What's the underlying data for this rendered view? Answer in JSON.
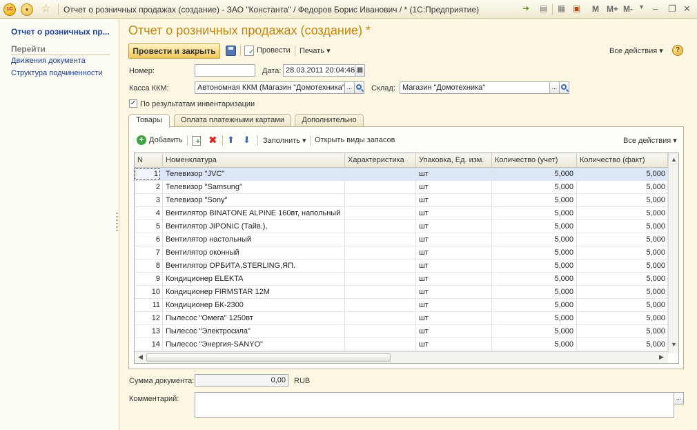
{
  "window": {
    "title": "Отчет о розничных продажах (создание) - ЗАО \"Константа\" / Федоров Борис Иванович / * (1С:Предприятие)",
    "logo": "1С",
    "menu_glyph": "▾",
    "favorite_glyph": "☆",
    "memory_buttons": [
      "M",
      "M+",
      "M-"
    ],
    "minimize": "–",
    "restore": "❐",
    "close": "✕"
  },
  "left_panel": {
    "title": "Отчет о розничных пр...",
    "section": "Перейти",
    "links": [
      "Движения документа",
      "Структура подчиненности"
    ]
  },
  "form": {
    "title": "Отчет о розничных продажах (создание) *",
    "toolbar": {
      "post_and_close": "Провести и закрыть",
      "post": "Провести",
      "print": "Печать ▾",
      "all_actions": "Все действия ▾",
      "help": "?"
    },
    "fields": {
      "number_label": "Номер:",
      "number_value": "",
      "date_label": "Дата:",
      "date_value": "28.03.2011 20:04:46",
      "cash_label": "Касса ККМ:",
      "cash_value": "Автономная ККМ (Магазин \"Домотехника\")",
      "warehouse_label": "Склад:",
      "warehouse_value": "Магазин \"Домотехника\"",
      "ellipsis": "...",
      "inventory_checkbox_label": "По результатам инвентаризации",
      "inventory_checked": "✓"
    },
    "tabs": [
      "Товары",
      "Оплата платежными картами",
      "Дополнительно"
    ],
    "table_toolbar": {
      "add": "Добавить",
      "add_glyph": "+",
      "delete_glyph": "✖",
      "up_glyph": "⬆",
      "down_glyph": "⬇",
      "fill": "Заполнить ▾",
      "open_stock_types": "Открыть виды запасов",
      "all_actions": "Все действия ▾"
    },
    "table": {
      "columns": [
        "N",
        "Номенклатура",
        "Характеристика",
        "Упаковка, Ед. изм.",
        "Количество (учет)",
        "Количество (факт)"
      ],
      "rows": [
        {
          "n": "1",
          "name": "Телевизор \"JVC\"",
          "char": "",
          "unit": "шт",
          "q1": "5,000",
          "q2": "5,000"
        },
        {
          "n": "2",
          "name": "Телевизор \"Samsung\"",
          "char": "",
          "unit": "шт",
          "q1": "5,000",
          "q2": "5,000"
        },
        {
          "n": "3",
          "name": "Телевизор \"Sony\"",
          "char": "",
          "unit": "шт",
          "q1": "5,000",
          "q2": "5,000"
        },
        {
          "n": "4",
          "name": "Вентилятор BINATONE ALPINE 160вт, напольный",
          "char": "",
          "unit": "шт",
          "q1": "5,000",
          "q2": "5,000"
        },
        {
          "n": "5",
          "name": "Вентилятор JIPONIC (Тайв.),",
          "char": "",
          "unit": "шт",
          "q1": "5,000",
          "q2": "5,000"
        },
        {
          "n": "6",
          "name": "Вентилятор настольный",
          "char": "",
          "unit": "шт",
          "q1": "5,000",
          "q2": "5,000"
        },
        {
          "n": "7",
          "name": "Вентилятор оконный",
          "char": "",
          "unit": "шт",
          "q1": "5,000",
          "q2": "5,000"
        },
        {
          "n": "8",
          "name": "Вентилятор ОРБИТА,STERLING,ЯП.",
          "char": "",
          "unit": "шт",
          "q1": "5,000",
          "q2": "5,000"
        },
        {
          "n": "9",
          "name": "Кондиционер ELEKTA",
          "char": "",
          "unit": "шт",
          "q1": "5,000",
          "q2": "5,000"
        },
        {
          "n": "10",
          "name": "Кондиционер FIRMSTAR 12M",
          "char": "",
          "unit": "шт",
          "q1": "5,000",
          "q2": "5,000"
        },
        {
          "n": "11",
          "name": "Кондиционер БК-2300",
          "char": "",
          "unit": "шт",
          "q1": "5,000",
          "q2": "5,000"
        },
        {
          "n": "12",
          "name": "Пылесос \"Омега\" 1250вт",
          "char": "",
          "unit": "шт",
          "q1": "5,000",
          "q2": "5,000"
        },
        {
          "n": "13",
          "name": "Пылесос \"Электросила\"",
          "char": "",
          "unit": "шт",
          "q1": "5,000",
          "q2": "5,000"
        },
        {
          "n": "14",
          "name": "Пылесос \"Энергия-SANYO\"",
          "char": "",
          "unit": "шт",
          "q1": "5,000",
          "q2": "5,000"
        }
      ],
      "scroll": {
        "up": "▲",
        "down": "▼",
        "left": "◀",
        "right": "▶"
      }
    },
    "footer": {
      "sum_label": "Сумма документа:",
      "sum_value": "0,00",
      "currency": "RUB",
      "comment_label": "Комментарий:",
      "comment_value": "",
      "ellipsis": "..."
    }
  },
  "colors": {
    "accent_title": "#c2850d",
    "link": "#1c3f95",
    "selected_row": "#dbe6f6",
    "primary_button": "#f0c75a",
    "background": "#fbf7e3"
  }
}
